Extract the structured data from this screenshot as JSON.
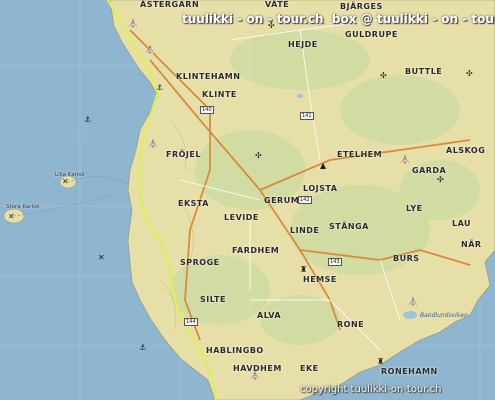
{
  "watermark": {
    "top": "tuulikki - on - tour.ch",
    "box": "box",
    "top_copy": "@ tuulikki - on - tour.ch",
    "bottom": "copyright tuulikki-on-tour.ch"
  },
  "places": {
    "vate": "VÄTE",
    "bjarges": "BJÄRGES",
    "astergarn": "ÄSTERGARN",
    "hejde": "HEJDE",
    "guldrupe": "GULDRUPE",
    "butle": "BUTTLE",
    "klintehamn": "KLINTEHAMN",
    "klinte": "KLINTE",
    "frojel": "FRÖJEL",
    "etelhem": "ETELHEM",
    "alskog": "ALSKOG",
    "lojsta": "LOJSTA",
    "garda": "GARDA",
    "gerum": "GERUM",
    "ekst a": "EKSTA",
    "levide": "LEVIDE",
    "lye": "LYE",
    "lau": "LAU",
    "stanga": "STÅNGA",
    "linde": "LINDE",
    "fardhem": "FARDHEM",
    "nar": "NÄR",
    "burs": "BURS",
    "sproge": "SPROGE",
    "hemse": "HEMSE",
    "silte": "SILTE",
    "alva": "ALVA",
    "rone": "RONE",
    "hablingbo": "HABLINGBO",
    "havdhem": "HAVDHEM",
    "eke": "EKE",
    "ronehamn": "RONEHAMN",
    "lilla_karlso": "Lilla Karlsö",
    "stora_karlso": "Stora Karlsö",
    "ronehamn_bay": "Bandlundsviken"
  },
  "roads": [
    "140",
    "142",
    "143",
    "144",
    "141"
  ],
  "colors": {
    "sea": "#8fb6d0",
    "land": "#e6dfa9",
    "forest": "#cdd9a0",
    "route": "#d8f050",
    "road_main": "#d98a3a",
    "grid": "#9cc0d8"
  },
  "icons": [
    "anchor-icon",
    "church-icon",
    "windmill-icon",
    "campsite-icon",
    "bird-icon",
    "castle-icon"
  ]
}
